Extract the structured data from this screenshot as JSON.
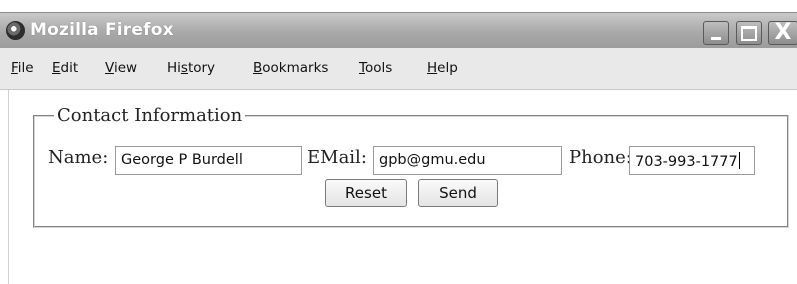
{
  "window": {
    "title": "Mozilla Firefox",
    "controls": {
      "minimize": "_",
      "maximize": "□",
      "close": "X"
    }
  },
  "menubar": {
    "items": [
      {
        "label": "File",
        "mnemonic": "F",
        "rest": "ile"
      },
      {
        "label": "Edit",
        "mnemonic": "E",
        "rest": "dit"
      },
      {
        "label": "View",
        "mnemonic": "V",
        "rest": "iew"
      },
      {
        "label": "History",
        "pre": "Hi",
        "mnemonic": "s",
        "rest": "tory"
      },
      {
        "label": "Bookmarks",
        "mnemonic": "B",
        "rest": "ookmarks"
      },
      {
        "label": "Tools",
        "mnemonic": "T",
        "rest": "ools"
      },
      {
        "label": "Help",
        "mnemonic": "H",
        "rest": "elp"
      }
    ]
  },
  "form": {
    "legend": "Contact Information",
    "name_label": "Name:",
    "name_value": "George P Burdell",
    "email_label": "EMail:",
    "email_value": "gpb@gmu.edu",
    "phone_label": "Phone:",
    "phone_value": "703-993-1777",
    "reset_label": "Reset",
    "send_label": "Send"
  }
}
